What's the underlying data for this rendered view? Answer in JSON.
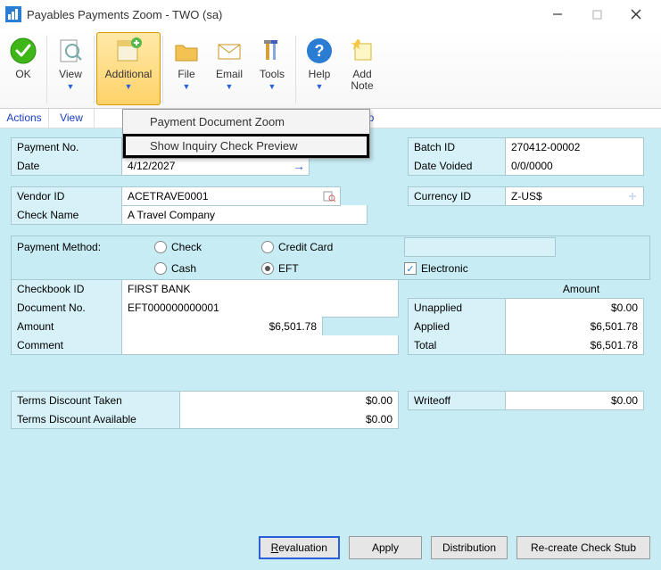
{
  "window": {
    "title": "Payables Payments Zoom  -  TWO (sa)"
  },
  "ribbon": {
    "ok": "OK",
    "view": "View",
    "additional": "Additional",
    "file": "File",
    "email": "Email",
    "tools": "Tools",
    "help": "Help",
    "add_note": "Add\nNote"
  },
  "groups": {
    "actions": "Actions",
    "view": "View",
    "help": "Help"
  },
  "menu": {
    "item1": "Payment Document Zoom",
    "item2": "Show Inquiry Check Preview"
  },
  "labels": {
    "payment_no": "Payment No.",
    "date": "Date",
    "vendor_id": "Vendor ID",
    "check_name": "Check Name",
    "payment_method": "Payment Method:",
    "check": "Check",
    "cash": "Cash",
    "credit_card": "Credit Card",
    "eft": "EFT",
    "electronic": "Electronic",
    "checkbook_id": "Checkbook ID",
    "document_no": "Document No.",
    "amount": "Amount",
    "comment": "Comment",
    "batch_id": "Batch ID",
    "date_voided": "Date Voided",
    "currency_id": "Currency ID",
    "amount_header": "Amount",
    "unapplied": "Unapplied",
    "applied": "Applied",
    "total": "Total",
    "terms_discount_taken": "Terms Discount Taken",
    "terms_discount_available": "Terms Discount Available",
    "writeoff": "Writeoff"
  },
  "values": {
    "payment_no": "",
    "date": "4/12/2027",
    "vendor_id": "ACETRAVE0001",
    "check_name": "A Travel Company",
    "checkbook_id": "FIRST BANK",
    "document_no": "EFT000000000001",
    "amount": "$6,501.78",
    "comment": "",
    "batch_id": "270412-00002",
    "date_voided": "0/0/0000",
    "currency_id": "Z-US$",
    "unapplied": "$0.00",
    "applied": "$6,501.78",
    "total": "$6,501.78",
    "terms_discount_taken": "$0.00",
    "terms_discount_available": "$0.00",
    "writeoff": "$0.00"
  },
  "buttons": {
    "revaluation": "Revaluation",
    "apply": "Apply",
    "distribution": "Distribution",
    "recreate": "Re-create Check Stub"
  }
}
